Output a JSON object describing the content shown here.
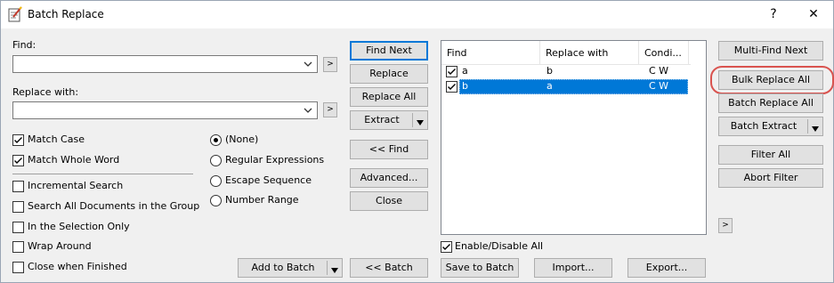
{
  "window": {
    "title": "Batch Replace",
    "help_label": "?",
    "close_label": "✕"
  },
  "find": {
    "label": "Find:",
    "value": "",
    "more_label": ">"
  },
  "replace": {
    "label": "Replace with:",
    "value": "",
    "more_label": ">"
  },
  "options": {
    "match_case": "Match Case",
    "match_whole_word": "Match Whole Word",
    "incremental_search": "Incremental Search",
    "search_all_documents": "Search All Documents in the Group",
    "in_selection_only": "In the Selection Only",
    "wrap_around": "Wrap Around",
    "close_when_finished": "Close when Finished"
  },
  "mode": {
    "none": "(None)",
    "regex": "Regular Expressions",
    "escape": "Escape Sequence",
    "number_range": "Number Range"
  },
  "buttons": {
    "find_next": "Find Next",
    "replace": "Replace",
    "replace_all": "Replace All",
    "extract": "Extract",
    "prev_find": "<< Find",
    "advanced": "Advanced...",
    "close": "Close",
    "add_to_batch": "Add to Batch",
    "prev_batch": "<< Batch",
    "save_to_batch": "Save to Batch",
    "import": "Import...",
    "export": "Export...",
    "multi_find_next": "Multi-Find Next",
    "bulk_replace_all": "Bulk Replace All",
    "batch_replace_all": "Batch Replace All",
    "batch_extract": "Batch Extract",
    "filter_all": "Filter All",
    "abort_filter": "Abort Filter",
    "more_right": ">"
  },
  "batch_list": {
    "columns": [
      "Find",
      "Replace with",
      "Condi..."
    ],
    "rows": [
      {
        "find": "a",
        "replace": "b",
        "cond": "C  W",
        "checked": true,
        "selected": false
      },
      {
        "find": "b",
        "replace": "a",
        "cond": "C  W",
        "checked": true,
        "selected": true
      }
    ]
  },
  "enable_disable_all": "Enable/Disable All"
}
